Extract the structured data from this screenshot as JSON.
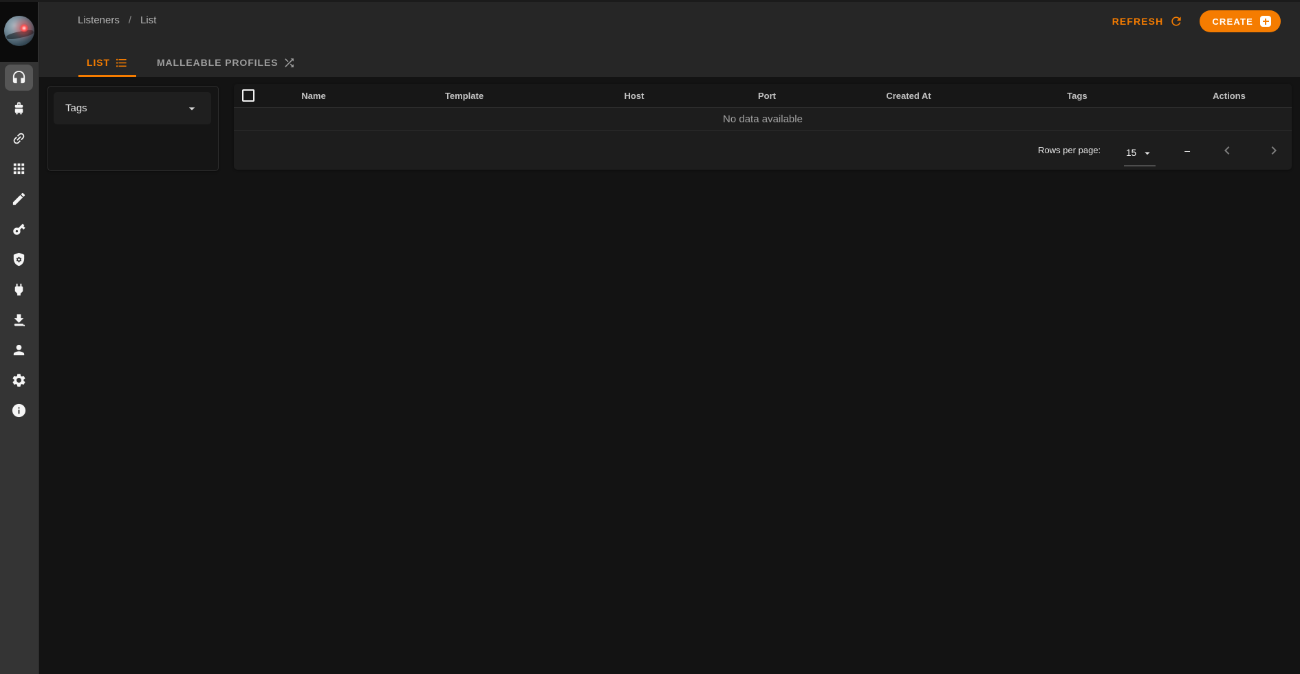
{
  "colors": {
    "accent": "#f57c00",
    "header_bg": "#262626",
    "content_bg": "#131313",
    "card_bg": "#1d1d1d",
    "rail_bg": "#343434"
  },
  "breadcrumb": {
    "items": [
      "Listeners",
      "List"
    ],
    "separator": "/"
  },
  "header": {
    "refresh_label": "REFRESH",
    "create_label": "CREATE"
  },
  "tabs": [
    {
      "label": "LIST",
      "icon": "list-icon",
      "active": true
    },
    {
      "label": "MALLEABLE PROFILES",
      "icon": "shuffle-icon",
      "active": false
    }
  ],
  "filters": {
    "tags_label": "Tags",
    "caret_icon": "arrow-drop-down-icon"
  },
  "table": {
    "columns": [
      "Name",
      "Template",
      "Host",
      "Port",
      "Created At",
      "Tags",
      "Actions"
    ],
    "empty_text": "No data available"
  },
  "pagination": {
    "rows_per_page_label": "Rows per page:",
    "rows_per_page_value": "15",
    "range_text": "–",
    "prev_icon": "chevron-left-icon",
    "next_icon": "chevron-right-icon"
  },
  "sidebar": {
    "icons": [
      "headset-icon",
      "luggage-icon",
      "link-icon",
      "apps-grid-icon",
      "pencil-icon",
      "key-icon",
      "shield-gear-icon",
      "plug-icon",
      "download-icon",
      "person-icon",
      "gear-icon",
      "info-icon"
    ]
  }
}
